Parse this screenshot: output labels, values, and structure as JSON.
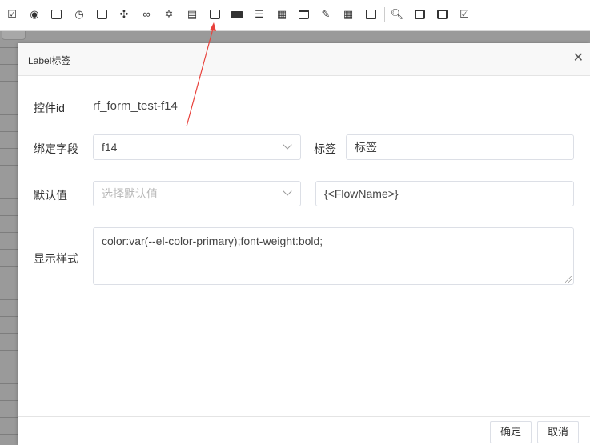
{
  "toolbar": {
    "icons": [
      "checkbox-icon",
      "radio-icon",
      "textarea-icon",
      "clock-icon",
      "frame-icon",
      "group-icon",
      "link-icon",
      "star-icon",
      "document-icon",
      "label-icon",
      "button-icon",
      "sort-icon",
      "table-icon",
      "window-icon",
      "pen-icon",
      "grid-table-icon",
      "code-file-icon",
      "preview-icon",
      "save-icon",
      "save-as-icon",
      "submit-icon"
    ]
  },
  "dialog": {
    "title": "Label标签",
    "close_glyph": "✕",
    "control_id_label": "控件id",
    "control_id_value": "rf_form_test-f14",
    "bind_field_label": "绑定字段",
    "bind_field_value": "f14",
    "tag_label": "标签",
    "tag_value": "标签",
    "default_label": "默认值",
    "default_placeholder": "选择默认值",
    "default_expression": "{<FlowName>}",
    "style_label": "显示样式",
    "style_value": "color:var(--el-color-primary);font-weight:bold;",
    "ok_button": "确定",
    "cancel_button": "取消"
  },
  "colors": {
    "annotation_arrow": "#e8413b",
    "border": "#dcdfe6",
    "header_bg": "#f8f8f8"
  }
}
